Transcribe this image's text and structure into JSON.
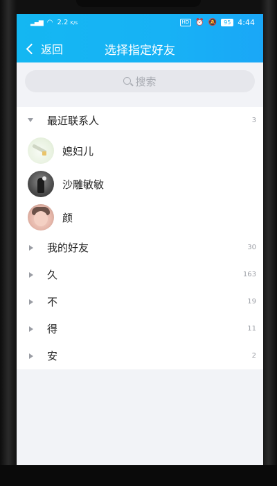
{
  "status_bar": {
    "signal": "⁴⁶ᵢₗ",
    "speed_top": "2.2",
    "speed_unit": "K/s",
    "hd": "HD",
    "battery": "95",
    "time": "4:44"
  },
  "nav": {
    "back_label": "返回",
    "title": "选择指定好友"
  },
  "search": {
    "placeholder": "搜索"
  },
  "groups": [
    {
      "label": "最近联系人",
      "count": "3",
      "expanded": true
    },
    {
      "label": "我的好友",
      "count": "30",
      "expanded": false
    },
    {
      "label": "久",
      "count": "163",
      "expanded": false
    },
    {
      "label": "不",
      "count": "19",
      "expanded": false
    },
    {
      "label": "得",
      "count": "11",
      "expanded": false
    },
    {
      "label": "安",
      "count": "2",
      "expanded": false
    }
  ],
  "recent_contacts": [
    {
      "name": "媳妇儿"
    },
    {
      "name": "沙雕敏敏"
    },
    {
      "name": "颜"
    }
  ],
  "colors": {
    "header_accent": "#17b2f5",
    "background": "#f2f3f7"
  }
}
